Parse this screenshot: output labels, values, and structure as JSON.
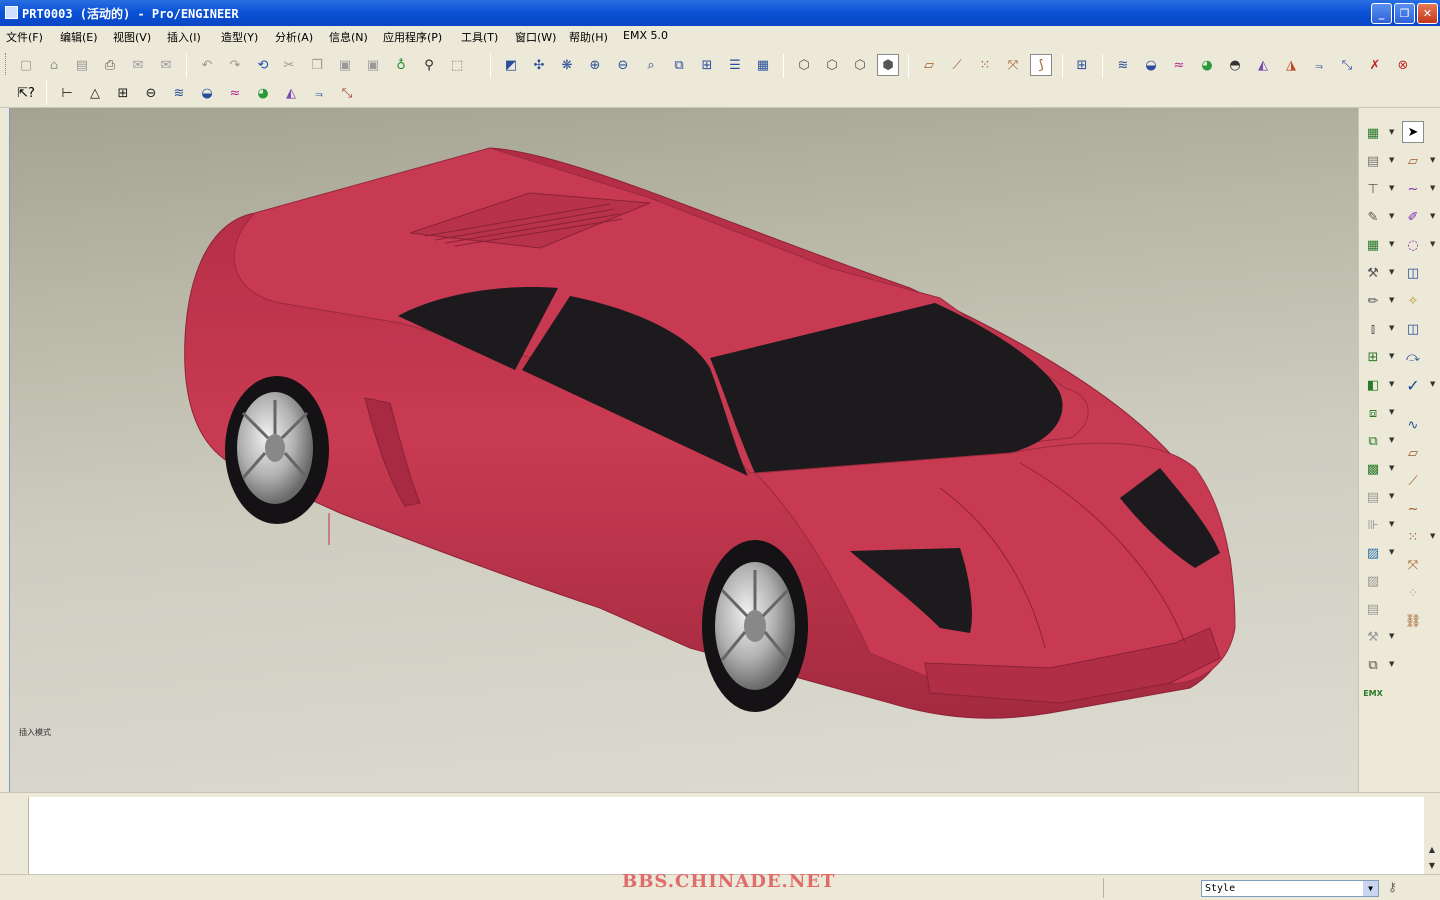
{
  "window": {
    "title": "PRT0003 (活动的) - Pro/ENGINEER",
    "controls": {
      "minimize": "_",
      "maximize": "❐",
      "close": "✕"
    }
  },
  "menubar": {
    "items": [
      "文件(F)",
      "编辑(E)",
      "视图(V)",
      "插入(I)",
      "造型(Y)",
      "分析(A)",
      "信息(N)",
      "应用程序(P)",
      "工具(T)",
      "窗口(W)",
      "帮助(H)",
      "EMX 5.0"
    ]
  },
  "toolbar_row1": {
    "icons": [
      "new-file-icon",
      "open-icon",
      "save-icon",
      "print-icon",
      "send-mail-icon",
      "send-mail-alt-icon",
      "undo-icon",
      "redo-icon",
      "regenerate-icon",
      "cut-icon",
      "copy-icon",
      "paste-icon",
      "paste-special-icon",
      "regen-manager-icon",
      "find-icon",
      "selection-box-icon",
      "repaint-icon",
      "spin-center-icon",
      "orient-mode-icon",
      "zoom-in-icon",
      "zoom-out-icon",
      "refit-icon",
      "reorient-icon",
      "saved-views-icon",
      "layers-icon",
      "view-manager-icon",
      "wireframe-icon",
      "hidden-line-icon",
      "no-hidden-icon",
      "shading-icon",
      "datum-planes-icon",
      "datum-axes-icon",
      "datum-points-icon",
      "csys-icon",
      "annotation-display-icon",
      "grid-snap-icon",
      "curvature-icon",
      "reflection-icon",
      "draft-check-icon",
      "shade-curvature-icon",
      "slope-icon",
      "offset-icon",
      "deviation-icon",
      "dihedral-icon",
      "tangent-icon",
      "connection-icon",
      "delete-analysis-icon",
      "hide-analysis-icon"
    ],
    "active_icon": "shading-icon"
  },
  "toolbar_row2": {
    "icons": [
      "context-help-icon",
      "measure-icon",
      "angle-icon",
      "area-icon",
      "diameter-icon",
      "curvature-analysis-icon",
      "surface-analysis-icon",
      "curve-analysis-icon",
      "gauss-icon",
      "section-icon",
      "offset-analysis-icon",
      "clear-analysis-icon"
    ]
  },
  "right_toolbar": {
    "left_column": [
      "extrude-tool-icon",
      "revolve-tool-icon",
      "hole-tool-icon",
      "shell-tool-icon",
      "rib-tool-icon",
      "draft-tool-icon",
      "round-tool-icon",
      "chamfer-tool-icon",
      "pattern-tool-icon",
      "mirror-tool-icon",
      "merge-tool-icon",
      "trim-tool-icon",
      "extend-tool-icon",
      "offset-tool-icon",
      "thicken-tool-icon",
      "solidify-tool-icon",
      "style-tool-icon",
      "boundary-tool-icon",
      "variable-section-icon",
      "blend-tool-icon",
      "warp-tool-icon",
      "emx-icon"
    ],
    "right_column": [
      "select-arrow-icon",
      "sketch-plane-icon",
      "curve-tool-icon",
      "free-curve-icon",
      "surface-tool-icon",
      "fill-surface-icon",
      "boundary-blend-icon",
      "curve-network-icon",
      "connect-surface-icon",
      "accept-check-icon",
      "plane-icon",
      "point-icon",
      "axis-icon",
      "sketch-curve-icon",
      "csys-point-icon",
      "offset-csys-icon",
      "datum-feature-icon",
      "chain-icon"
    ]
  },
  "viewport": {
    "model_label": "插入模式",
    "model": "sports-car"
  },
  "status": {
    "watermark": "BBS.CHINADE.NET",
    "filter_value": "Style",
    "filter_arrow": "▼"
  },
  "colors": {
    "titlebar": "#0b52d8",
    "car_body": "#c7384e",
    "car_glass": "#1c1a1d",
    "viewport_top": "#a4a292",
    "viewport_bottom": "#dedcd1"
  }
}
